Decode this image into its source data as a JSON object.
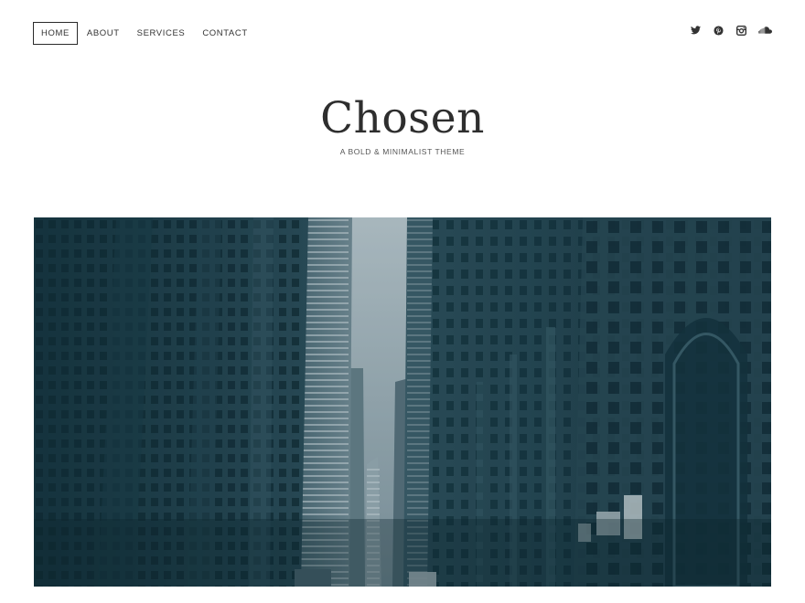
{
  "nav": {
    "items": [
      {
        "label": "HOME",
        "active": true
      },
      {
        "label": "ABOUT",
        "active": false
      },
      {
        "label": "SERVICES",
        "active": false
      },
      {
        "label": "CONTACT",
        "active": false
      }
    ]
  },
  "social": {
    "icons": [
      "twitter-icon",
      "pinterest-icon",
      "instagram-icon",
      "soundcloud-icon"
    ]
  },
  "branding": {
    "title": "Chosen",
    "tagline": "A BOLD & MINIMALIST THEME"
  },
  "hero": {
    "subject": "city street between tall buildings"
  },
  "colors": {
    "text": "#2e2e2e",
    "hero_tint": "#1f3a44"
  }
}
